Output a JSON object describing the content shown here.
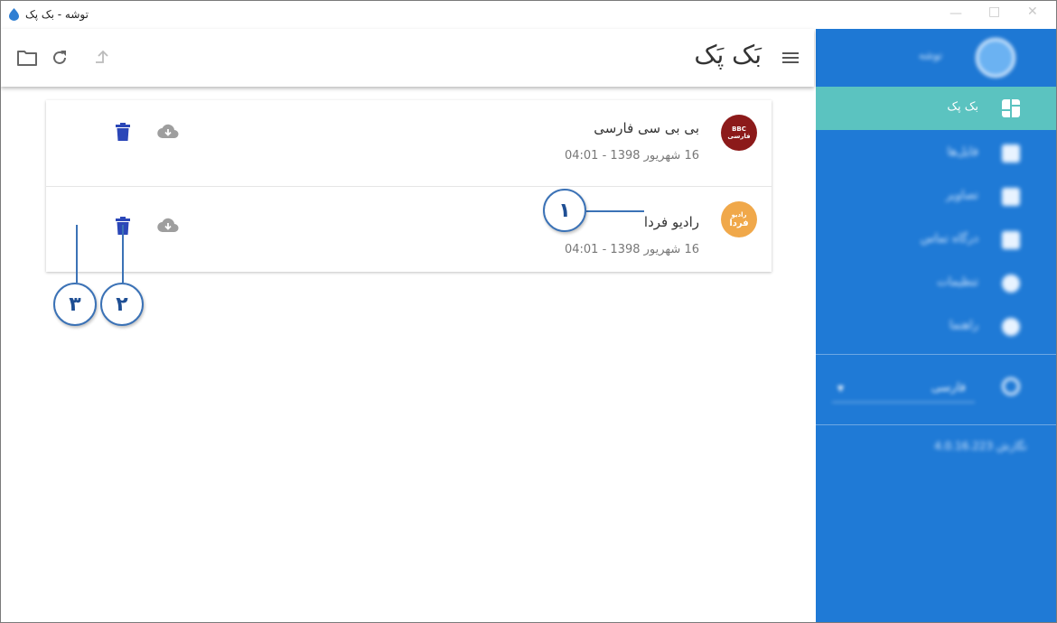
{
  "window": {
    "title": "توشه - بک پک",
    "controls": [
      "minimize-icon",
      "maximize-icon",
      "close-icon"
    ]
  },
  "appbar": {
    "title": "بَک پَک",
    "icons": [
      "folder-icon",
      "refresh-icon",
      "upload-icon",
      "menu-icon"
    ]
  },
  "items": [
    {
      "title": "بی بی سی فارسی",
      "date": "16 شهریور 1398 - 04:01",
      "logo_lines": [
        "BBC",
        "فارسی"
      ]
    },
    {
      "title": "رادیو فردا",
      "date": "16 شهریور 1398 - 04:01",
      "logo_lines": [
        "رادیو",
        "فردا"
      ]
    }
  ],
  "callouts": {
    "one": "۱",
    "two": "۲",
    "three": "۳"
  },
  "sidebar": {
    "user_name": "توشه",
    "items": [
      {
        "label": "بک پک",
        "icon": "dashboard-icon",
        "active": true
      },
      {
        "label": "فایل‌ها",
        "icon": "folder-icon"
      },
      {
        "label": "تصاویر",
        "icon": "image-icon"
      },
      {
        "label": "درگاه تماس",
        "icon": "contact-icon"
      },
      {
        "label": "تنظیمات",
        "icon": "settings-icon"
      },
      {
        "label": "راهنما",
        "icon": "help-icon"
      }
    ],
    "language": "فارسی",
    "version": "نگارش 4.0.16.223"
  },
  "colors": {
    "accent": "#1f7ad6",
    "active_item": "#5bc3c0",
    "delete_icon": "#2b47b8",
    "download_icon": "#9e9e9e",
    "callout_border": "#3b72b6"
  }
}
